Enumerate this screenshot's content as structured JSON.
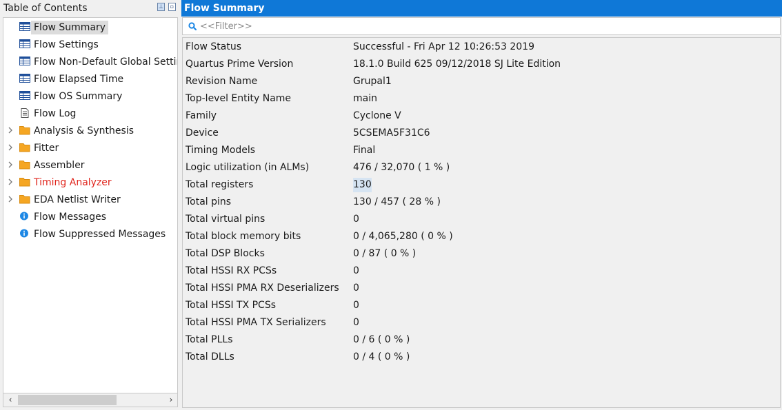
{
  "toc": {
    "title": "Table of Contents",
    "items": [
      {
        "label": "Flow Summary",
        "icon": "table-icon",
        "expandable": false,
        "selected": true,
        "red": false
      },
      {
        "label": "Flow Settings",
        "icon": "table-icon",
        "expandable": false,
        "selected": false,
        "red": false
      },
      {
        "label": "Flow Non-Default Global Settin",
        "icon": "table-icon",
        "expandable": false,
        "selected": false,
        "red": false
      },
      {
        "label": "Flow Elapsed Time",
        "icon": "table-icon",
        "expandable": false,
        "selected": false,
        "red": false
      },
      {
        "label": "Flow OS Summary",
        "icon": "table-icon",
        "expandable": false,
        "selected": false,
        "red": false
      },
      {
        "label": "Flow Log",
        "icon": "document-icon",
        "expandable": false,
        "selected": false,
        "red": false
      },
      {
        "label": "Analysis & Synthesis",
        "icon": "folder-icon",
        "expandable": true,
        "selected": false,
        "red": false
      },
      {
        "label": "Fitter",
        "icon": "folder-icon",
        "expandable": true,
        "selected": false,
        "red": false
      },
      {
        "label": "Assembler",
        "icon": "folder-icon",
        "expandable": true,
        "selected": false,
        "red": false
      },
      {
        "label": "Timing Analyzer",
        "icon": "folder-icon",
        "expandable": true,
        "selected": false,
        "red": true
      },
      {
        "label": "EDA Netlist Writer",
        "icon": "folder-icon",
        "expandable": true,
        "selected": false,
        "red": false
      },
      {
        "label": "Flow Messages",
        "icon": "info-icon",
        "expandable": false,
        "selected": false,
        "red": false
      },
      {
        "label": "Flow Suppressed Messages",
        "icon": "info-icon",
        "expandable": false,
        "selected": false,
        "red": false
      }
    ]
  },
  "main": {
    "title": "Flow Summary",
    "filter_placeholder": "<<Filter>>",
    "rows": [
      {
        "key": "Flow Status",
        "value": "Successful - Fri Apr 12 10:26:53 2019",
        "highlight": false
      },
      {
        "key": "Quartus Prime Version",
        "value": "18.1.0 Build 625 09/12/2018 SJ Lite Edition",
        "highlight": false
      },
      {
        "key": "Revision Name",
        "value": "Grupal1",
        "highlight": false
      },
      {
        "key": "Top-level Entity Name",
        "value": "main",
        "highlight": false
      },
      {
        "key": "Family",
        "value": "Cyclone V",
        "highlight": false
      },
      {
        "key": "Device",
        "value": "5CSEMA5F31C6",
        "highlight": false
      },
      {
        "key": "Timing Models",
        "value": "Final",
        "highlight": false
      },
      {
        "key": "Logic utilization (in ALMs)",
        "value": "476 / 32,070 ( 1 % )",
        "highlight": false
      },
      {
        "key": "Total registers",
        "value": "130",
        "highlight": true
      },
      {
        "key": "Total pins",
        "value": "130 / 457 ( 28 % )",
        "highlight": false
      },
      {
        "key": "Total virtual pins",
        "value": "0",
        "highlight": false
      },
      {
        "key": "Total block memory bits",
        "value": "0 / 4,065,280 ( 0 % )",
        "highlight": false
      },
      {
        "key": "Total DSP Blocks",
        "value": "0 / 87 ( 0 % )",
        "highlight": false
      },
      {
        "key": "Total HSSI RX PCSs",
        "value": "0",
        "highlight": false
      },
      {
        "key": "Total HSSI PMA RX Deserializers",
        "value": "0",
        "highlight": false
      },
      {
        "key": "Total HSSI TX PCSs",
        "value": "0",
        "highlight": false
      },
      {
        "key": "Total HSSI PMA TX Serializers",
        "value": "0",
        "highlight": false
      },
      {
        "key": "Total PLLs",
        "value": "0 / 6 ( 0 % )",
        "highlight": false
      },
      {
        "key": "Total DLLs",
        "value": "0 / 4 ( 0 % )",
        "highlight": false
      }
    ]
  },
  "colors": {
    "title_bar": "#0f78d7",
    "error_text": "#e0251c",
    "folder": "#f5a623",
    "info": "#1e88e5",
    "table_icon": "#1f4f9a"
  }
}
